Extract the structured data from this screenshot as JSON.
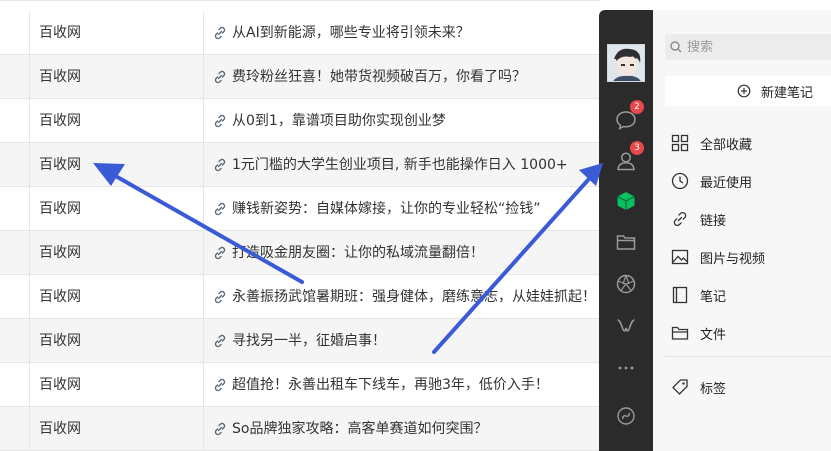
{
  "table": {
    "rows": [
      {
        "source": "百收网",
        "title": "从AI到新能源，哪些专业将引领未来？"
      },
      {
        "source": "百收网",
        "title": "费玲粉丝狂喜！她带货视频破百万，你看了吗？"
      },
      {
        "source": "百收网",
        "title": "从0到1，靠谱项目助你实现创业梦"
      },
      {
        "source": "百收网",
        "title": "1元门槛的大学生创业项目, 新手也能操作日入 1000+"
      },
      {
        "source": "百收网",
        "title": "赚钱新姿势：自媒体嫁接，让你的专业轻松“捡钱”"
      },
      {
        "source": "百收网",
        "title": "打造吸金朋友圈：让你的私域流量翻倍！"
      },
      {
        "source": "百收网",
        "title": "永善振扬武馆暑期班：强身健体，磨练意志，从娃娃抓起！"
      },
      {
        "source": "百收网",
        "title": "寻找另一半，征婚启事！"
      },
      {
        "source": "百收网",
        "title": "超值抢！永善出租车下线车，再驰3年，低价入手！"
      },
      {
        "source": "百收网",
        "title": "So品牌独家攻略：高客单赛道如何突围？"
      }
    ]
  },
  "rail": {
    "items": [
      {
        "name": "chat-icon",
        "badge": "2"
      },
      {
        "name": "contacts-icon",
        "badge": "3"
      },
      {
        "name": "cube-icon",
        "badge": ""
      },
      {
        "name": "folder-icon",
        "badge": ""
      },
      {
        "name": "aperture-icon",
        "badge": ""
      },
      {
        "name": "mini-program-icon",
        "badge": ""
      },
      {
        "name": "more-icon",
        "badge": ""
      },
      {
        "name": "channels-icon",
        "badge": ""
      }
    ]
  },
  "sidebar": {
    "search_placeholder": "搜索",
    "new_note_label": "新建笔记",
    "nav": [
      {
        "label": "全部收藏",
        "icon": "grid-icon"
      },
      {
        "label": "最近使用",
        "icon": "clock-icon"
      },
      {
        "label": "链接",
        "icon": "link-icon"
      },
      {
        "label": "图片与视频",
        "icon": "image-icon"
      },
      {
        "label": "笔记",
        "icon": "notebook-icon"
      },
      {
        "label": "文件",
        "icon": "folder-icon"
      }
    ],
    "tags_label": "标签"
  },
  "colors": {
    "rail_bg": "#2b2b2b",
    "sidebar_bg": "#f7f7f7",
    "badge": "#e9484a",
    "cube_green": "#07c160",
    "arrow_blue": "#3b5bd6"
  }
}
